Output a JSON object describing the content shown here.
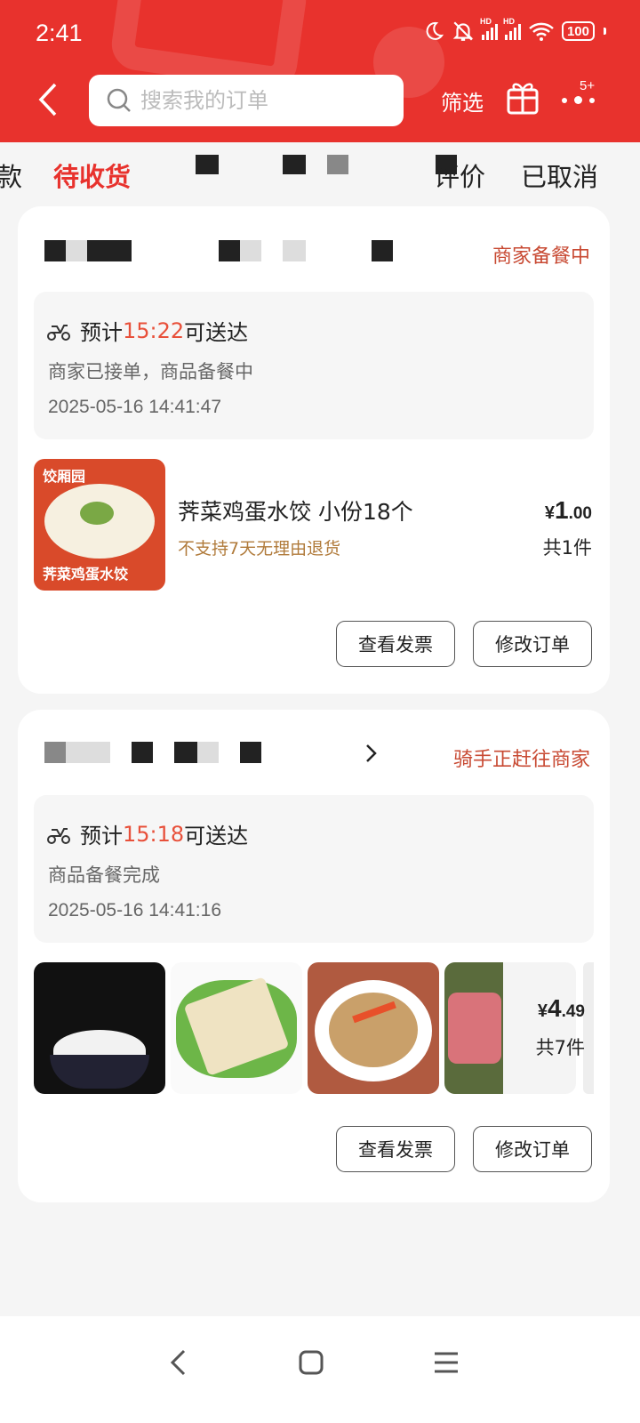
{
  "status_bar": {
    "time": "2:41",
    "battery": "100",
    "hd": "HD"
  },
  "search": {
    "placeholder": "搜索我的订单"
  },
  "header": {
    "filter_label": "筛选",
    "more_badge": "5+"
  },
  "tabs": [
    {
      "label": "款"
    },
    {
      "label": "待收货",
      "active": true
    },
    {
      "label": "待评价"
    },
    {
      "label": "已取消"
    }
  ],
  "orders": [
    {
      "status": "商家备餐中",
      "eta_prefix": "预计",
      "eta_time": "15:22",
      "eta_suffix": "可送达",
      "description": "商家已接单，商品备餐中",
      "timestamp": "2025-05-16 14:41:47",
      "item": {
        "title": "荠菜鸡蛋水饺 小份18个",
        "note": "不支持7天无理由退货",
        "thumb_brand": "饺厢园",
        "thumb_caption": "荠菜鸡蛋水饺"
      },
      "price": {
        "currency": "¥",
        "integer": "1",
        "decimal": ".00"
      },
      "quantity": "共1件",
      "buttons": {
        "invoice": "查看发票",
        "modify": "修改订单"
      }
    },
    {
      "status": "骑手正赶往商家",
      "eta_prefix": "预计",
      "eta_time": "15:18",
      "eta_suffix": "可送达",
      "description": "商品备餐完成",
      "timestamp": "2025-05-16 14:41:16",
      "price": {
        "currency": "¥",
        "integer": "4",
        "decimal": ".49"
      },
      "quantity": "共7件",
      "buttons": {
        "invoice": "查看发票",
        "modify": "修改订单"
      }
    }
  ],
  "colors": {
    "header_red": "#e8322d",
    "accent_red": "#e8503a",
    "status_text": "#c84a33",
    "note_brown": "#b07a3a"
  }
}
